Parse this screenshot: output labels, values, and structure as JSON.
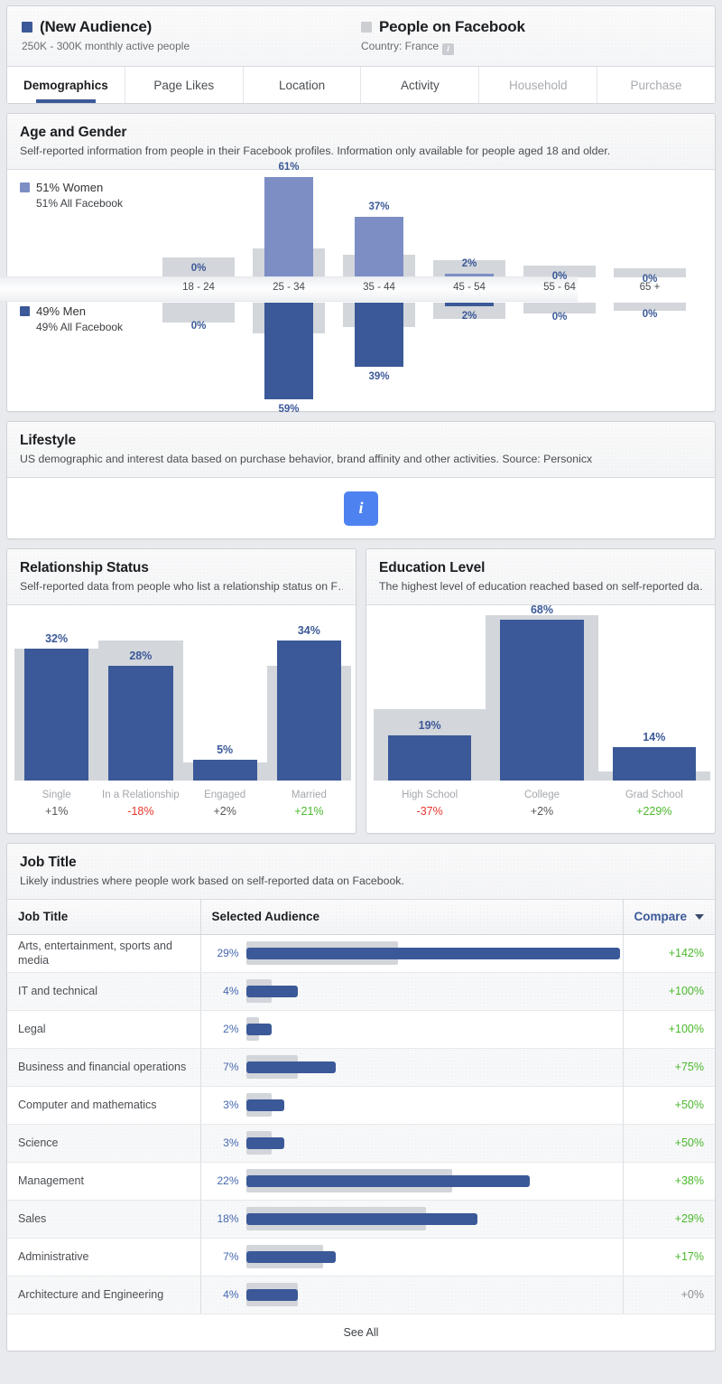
{
  "header": {
    "audience": {
      "swatch": "#3b5998",
      "title": "(New Audience)",
      "subtitle": "250K - 300K monthly active people"
    },
    "comparison": {
      "swatch": "#ccced2",
      "title": "People on Facebook",
      "subtitle": "Country: France",
      "info_icon": "info-icon"
    }
  },
  "tabs": [
    {
      "label": "Demographics",
      "active": true,
      "dim": false
    },
    {
      "label": "Page Likes",
      "active": false,
      "dim": false
    },
    {
      "label": "Location",
      "active": false,
      "dim": false
    },
    {
      "label": "Activity",
      "active": false,
      "dim": false
    },
    {
      "label": "Household",
      "active": false,
      "dim": true
    },
    {
      "label": "Purchase",
      "active": false,
      "dim": true
    }
  ],
  "age_gender": {
    "title": "Age and Gender",
    "subtitle": "Self-reported information from people in their Facebook profiles. Information only available for people aged 18 and older.",
    "legend": {
      "women_label": "51% Women",
      "women_sub": "51% All Facebook",
      "women_color": "#7c8ec4",
      "men_label": "49% Men",
      "men_sub": "49% All Facebook",
      "men_color": "#3b5998"
    }
  },
  "lifestyle": {
    "title": "Lifestyle",
    "subtitle": "US demographic and interest data based on purchase behavior, brand affinity and other activities. Source: Personicx",
    "info_glyph": "i",
    "info_color": "#4e82f0"
  },
  "relationship": {
    "title": "Relationship Status",
    "subtitle": "Self-reported data from people who list a relationship status on F…"
  },
  "education": {
    "title": "Education Level",
    "subtitle": "The highest level of education reached based on self-reported da…"
  },
  "job_title": {
    "title": "Job Title",
    "subtitle": "Likely industries where people work based on self-reported data on Facebook.",
    "columns": [
      "Job Title",
      "Selected Audience",
      "Compare"
    ],
    "sort_icon": "chevron-down-icon",
    "see_all": "See All"
  },
  "chart_data": [
    {
      "type": "bar",
      "title": "Age and Gender",
      "orientation": "diverging-vertical",
      "categories": [
        "18 - 24",
        "25 - 34",
        "35 - 44",
        "45 - 54",
        "55 - 64",
        "65 +"
      ],
      "series": [
        {
          "name": "51% Women",
          "color": "#7c8ec4",
          "direction": "up",
          "values": [
            0,
            61,
            37,
            2,
            0,
            0
          ],
          "labels": [
            "0%",
            "61%",
            "37%",
            "2%",
            "0%",
            "0%"
          ]
        },
        {
          "name": "49% Men",
          "color": "#3b5998",
          "direction": "down",
          "values": [
            0,
            59,
            39,
            2,
            0,
            0
          ],
          "labels": [
            "0%",
            "59%",
            "39%",
            "2%",
            "0%",
            "0%"
          ]
        },
        {
          "name": "All Facebook Women",
          "color": "#d3d6db",
          "direction": "up",
          "values": [
            17,
            25,
            19,
            15,
            10,
            8
          ]
        },
        {
          "name": "All Facebook Men",
          "color": "#d3d6db",
          "direction": "down",
          "values": [
            17,
            26,
            21,
            14,
            9,
            7
          ]
        }
      ],
      "ylabel": "",
      "xlabel": "",
      "grid": false,
      "legend_position": "left"
    },
    {
      "type": "bar",
      "title": "Relationship Status",
      "categories": [
        "Single",
        "In a Relationship",
        "Engaged",
        "Married"
      ],
      "values": [
        32,
        28,
        5,
        34
      ],
      "labels": [
        "32%",
        "28%",
        "5%",
        "34%"
      ],
      "comparison_values": [
        32,
        34,
        4.5,
        28
      ],
      "deltas": [
        "+1%",
        "-18%",
        "+2%",
        "+21%"
      ],
      "delta_dirs": [
        "flat",
        "down",
        "flat",
        "up"
      ],
      "ylim": [
        0,
        40
      ],
      "grid": false
    },
    {
      "type": "bar",
      "title": "Education Level",
      "categories": [
        "High School",
        "College",
        "Grad School"
      ],
      "values": [
        19,
        68,
        14
      ],
      "labels": [
        "19%",
        "68%",
        "14%"
      ],
      "comparison_values": [
        30,
        70,
        4
      ],
      "deltas": [
        "-37%",
        "+2%",
        "+229%"
      ],
      "delta_dirs": [
        "down",
        "flat",
        "up"
      ],
      "ylim": [
        0,
        75
      ],
      "grid": false
    },
    {
      "type": "table",
      "title": "Job Title",
      "columns": [
        "Job Title",
        "Selected Audience",
        "Compare"
      ],
      "rows": [
        {
          "title": "Arts, entertainment, sports and media",
          "pct": "29%",
          "value": 29,
          "compare_value": 11.8,
          "compare": "+142%",
          "dir": "up"
        },
        {
          "title": "IT and technical",
          "pct": "4%",
          "value": 4,
          "compare_value": 2.0,
          "compare": "+100%",
          "dir": "up"
        },
        {
          "title": "Legal",
          "pct": "2%",
          "value": 2,
          "compare_value": 1.0,
          "compare": "+100%",
          "dir": "up"
        },
        {
          "title": "Business and financial operations",
          "pct": "7%",
          "value": 7,
          "compare_value": 4.0,
          "compare": "+75%",
          "dir": "up"
        },
        {
          "title": "Computer and mathematics",
          "pct": "3%",
          "value": 3,
          "compare_value": 2.0,
          "compare": "+50%",
          "dir": "up"
        },
        {
          "title": "Science",
          "pct": "3%",
          "value": 3,
          "compare_value": 2.0,
          "compare": "+50%",
          "dir": "up"
        },
        {
          "title": "Management",
          "pct": "22%",
          "value": 22,
          "compare_value": 16.0,
          "compare": "+38%",
          "dir": "up"
        },
        {
          "title": "Sales",
          "pct": "18%",
          "value": 18,
          "compare_value": 14.0,
          "compare": "+29%",
          "dir": "up"
        },
        {
          "title": "Administrative",
          "pct": "7%",
          "value": 7,
          "compare_value": 6.0,
          "compare": "+17%",
          "dir": "up"
        },
        {
          "title": "Architecture and Engineering",
          "pct": "4%",
          "value": 4,
          "compare_value": 4.0,
          "compare": "+0%",
          "dir": "flat"
        }
      ]
    }
  ]
}
